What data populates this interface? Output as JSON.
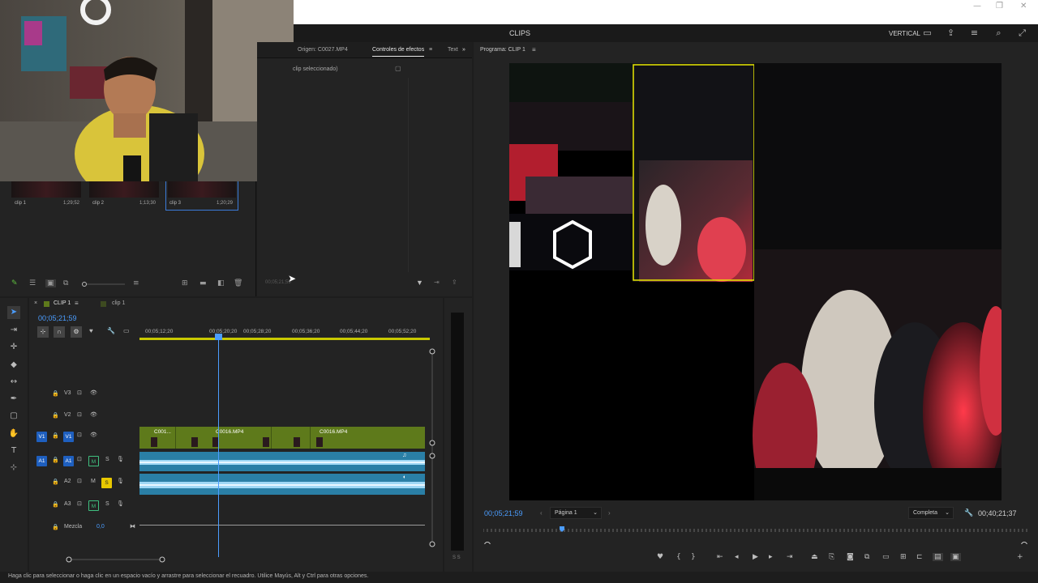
{
  "app": {
    "workspace_title": "CLIPS",
    "workspace_name": "VERTICAL",
    "colors": {
      "accent": "#4b9dff",
      "selection": "#e8e800",
      "video_clip": "#5e7a1b",
      "audio_clip": "#2a7fa6"
    }
  },
  "project": {
    "clips": [
      {
        "label": "clip 1",
        "duration": "1;29;52"
      },
      {
        "label": "clip 2",
        "duration": "1;13;30"
      },
      {
        "label": "clip 3",
        "duration": "1;20;29"
      }
    ]
  },
  "effects": {
    "tabs": [
      "Origen: C0027.MP4",
      "Controles de efectos",
      "Text"
    ],
    "no_clip_text": "clip seleccionado)",
    "timecode": "00;05;21;59"
  },
  "program": {
    "title": "Programa: CLIP 1",
    "timecode": "00;05;21;59",
    "page_select": "Página 1",
    "quality": "Completa",
    "duration": "00;40;21;37"
  },
  "timeline": {
    "tabs": [
      "CLIP 1",
      "clip 1"
    ],
    "timecode": "00;05;21;59",
    "ruler_labels": [
      "00;05;12;20",
      "00;05;20;20",
      "00;05;28;20",
      "00;05;36;20",
      "00;05;44;20",
      "00;05;52;20"
    ],
    "tracks": {
      "v3": "V3",
      "v2": "V2",
      "v1": "V1",
      "v1_src": "V1",
      "a1": "A1",
      "a1_src": "A1",
      "a2": "A2",
      "a3": "A3",
      "mute": "M",
      "solo": "S",
      "mix_label": "Mezcla",
      "mix_value": "0,0"
    },
    "video_clips": [
      "C001...",
      "C0016.MP4",
      "C0016.MP4"
    ]
  },
  "meter": {
    "labels": "S S"
  },
  "status_bar": "Haga clic para seleccionar o haga clic en un espacio vacío y arrastre para seleccionar el recuadro. Utilice Mayús, Alt y Ctrl para otras opciones."
}
